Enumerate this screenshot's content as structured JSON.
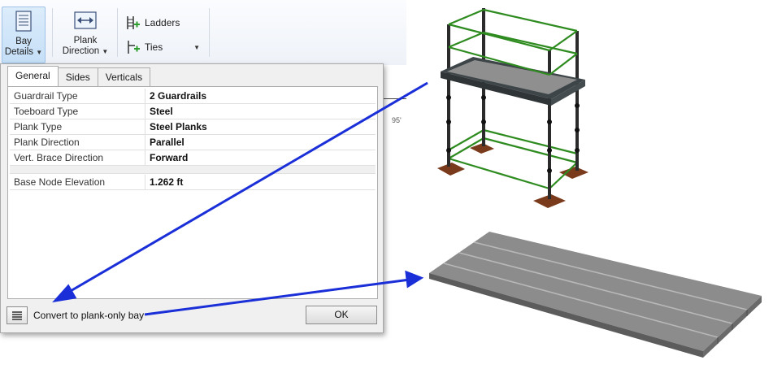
{
  "ribbon": {
    "bay_details": {
      "line1": "Bay",
      "line2": "Details",
      "icon": "bay-details-icon"
    },
    "plank_direction": {
      "line1": "Plank",
      "line2": "Direction",
      "icon": "plank-direction-icon"
    },
    "ladders": {
      "label": "Ladders",
      "icon": "ladder-icon"
    },
    "ties": {
      "label": "Ties",
      "icon": "tie-icon"
    }
  },
  "ruler": {
    "value": "95'"
  },
  "dialog": {
    "tabs": [
      "General",
      "Sides",
      "Verticals"
    ],
    "properties": [
      {
        "name": "Guardrail Type",
        "value": "2 Guardrails"
      },
      {
        "name": "Toeboard Type",
        "value": "Steel"
      },
      {
        "name": "Plank Type",
        "value": "Steel Planks"
      },
      {
        "name": "Plank Direction",
        "value": "Parallel"
      },
      {
        "name": "Vert. Brace Direction",
        "value": "Forward"
      }
    ],
    "elevation": {
      "name": "Base Node Elevation",
      "value": "1.262 ft"
    },
    "convert_label": "Convert to plank-only bay",
    "ok_label": "OK"
  },
  "colors": {
    "arrow": "#1a2fd8",
    "guardrail": "#2e8b1f",
    "plank": "#8c8c8c",
    "baseplate": "#7a3a1c"
  }
}
